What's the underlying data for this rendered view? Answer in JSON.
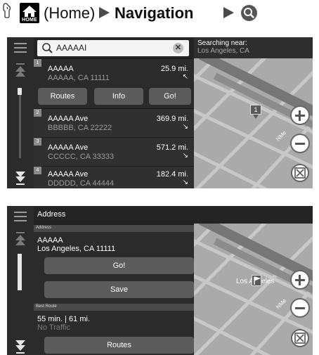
{
  "header": {
    "home_label": "HOME",
    "home_text": "(Home)",
    "navigation": "Navigation"
  },
  "screen1": {
    "search": {
      "query": "AAAAAI"
    },
    "search_near": {
      "label": "Searching near:",
      "location": "Los Angeles, CA"
    },
    "results": [
      {
        "index": "1",
        "name": "AAAAA",
        "address": "AAAAA, CA 11111",
        "distance": "25.9 mi.",
        "direction": "↖"
      },
      {
        "index": "2",
        "name": "AAAAA Ave",
        "address": "BBBBB, CA 22222",
        "distance": "369.9 mi.",
        "direction": "↘"
      },
      {
        "index": "3",
        "name": "AAAAA Ave",
        "address": "CCCCC, CA 33333",
        "distance": "571.2 mi.",
        "direction": "↘"
      },
      {
        "index": "4",
        "name": "AAAAA Ave",
        "address": "DDDDD, CA 44444",
        "distance": "182.4 mi.",
        "direction": "↘"
      }
    ],
    "actions": {
      "routes": "Routes",
      "info": "Info",
      "go": "Go!"
    },
    "map_pin": "1"
  },
  "screen2": {
    "title": "Address",
    "address_section": "Address",
    "address_line1": "AAAAA",
    "address_line2": "Los Angeles, CA 11111",
    "go": "Go!",
    "save": "Save",
    "best_route_section": "Best Route",
    "route_summary": "55 min. | 61 mi.",
    "traffic": "No Traffic",
    "routes": "Routes",
    "map_label": "Los Angeles"
  },
  "icons": [
    "voice-command-icon",
    "home-icon",
    "play-arrow-icon",
    "search-icon",
    "menu-icon",
    "scroll-up-icon",
    "scroll-down-icon",
    "clear-icon",
    "zoom-in-icon",
    "zoom-out-icon",
    "expand-map-icon",
    "map-pin-icon",
    "destination-flag-icon"
  ],
  "colors": {
    "screen_bg": "#1f1f1f",
    "map_bg": "#aaaaaa",
    "road_dark": "#6d6d6d",
    "button_bg": "#5b5b5b"
  }
}
